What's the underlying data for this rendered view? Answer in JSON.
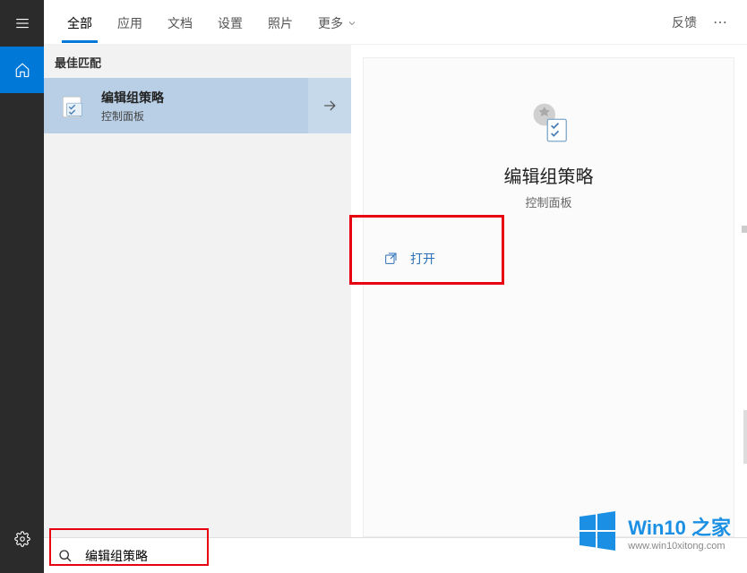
{
  "header": {
    "tabs": [
      "全部",
      "应用",
      "文档",
      "设置",
      "照片"
    ],
    "more": "更多",
    "feedback": "反馈"
  },
  "results": {
    "section": "最佳匹配",
    "item": {
      "title": "编辑组策略",
      "subtitle": "控制面板"
    }
  },
  "preview": {
    "title": "编辑组策略",
    "subtitle": "控制面板",
    "open": "打开"
  },
  "search": {
    "placeholder": "",
    "value": "编辑组策略"
  },
  "watermark": {
    "main": "Win10 之家",
    "sub": "www.win10xitong.com"
  }
}
